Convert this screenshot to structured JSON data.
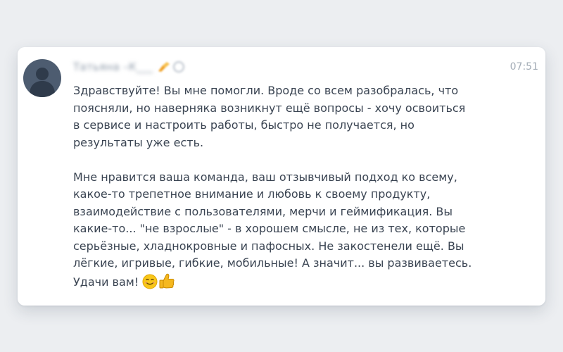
{
  "message": {
    "sender_name": "Татьяна –К___",
    "time": "07:51",
    "paragraph_1": "Здравствуйте! Вы мне помогли. Вроде со всем разобралась, что\nпоясняли, но наверняка возникнут ещё вопросы - хочу освоиться\nв сервисе и настроить работы, быстро не получается, но\nрезультаты уже есть.",
    "paragraph_2": "Мне нравится ваша команда, ваш отзывчивый подход ко всему,\nкакое-то трепетное внимание и любовь к своему продукту,\nвзаимодействие с пользователями, мерчи и геймификация. Вы\nкакие-то... \"не взрослые\" - в хорошем смысле, не из тех, которые\nсерьёзные, хладнокровные и пафосных. Не закостенели ещё. Вы\nлёгкие, игривые, гибкие, мобильные! А значит... вы развиваетесь.",
    "closing": "Удачи вам!",
    "emojis": [
      "smiling-face-emoji",
      "thumbs-up-emoji"
    ]
  },
  "avatar": {
    "icon": "user-silhouette-icon",
    "background_color": "#4d5c70",
    "figure_color": "#2f3b4b"
  },
  "colors": {
    "page_background": "#eceef1",
    "card_background": "#ffffff",
    "text": "#3a4452",
    "muted": "#a3acb6",
    "emoji_yellow": "#f5b81f"
  }
}
